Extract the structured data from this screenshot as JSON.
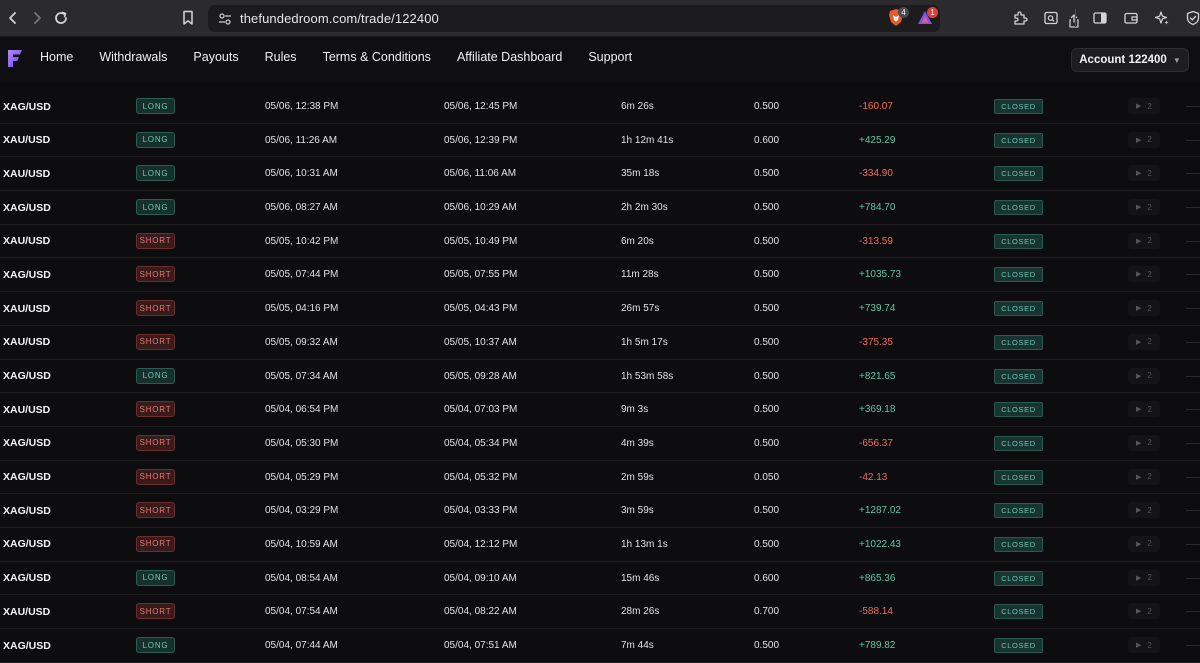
{
  "browser": {
    "url": "thefundedroom.com/trade/122400",
    "brave_badge": "4",
    "rewards_badge": "1"
  },
  "nav": {
    "items": [
      "Home",
      "Withdrawals",
      "Payouts",
      "Rules",
      "Terms & Conditions",
      "Affiliate Dashboard",
      "Support"
    ],
    "account_label": "Account 122400"
  },
  "trades": [
    {
      "symbol": "XAG/USD",
      "direction": "LONG",
      "open": "05/06, 12:38 PM",
      "close": "05/06, 12:45 PM",
      "duration": "6m 26s",
      "size": "0.500",
      "pnl": "-160.07",
      "status": "CLOSED",
      "count": "2"
    },
    {
      "symbol": "XAU/USD",
      "direction": "LONG",
      "open": "05/06, 11:26 AM",
      "close": "05/06, 12:39 PM",
      "duration": "1h 12m 41s",
      "size": "0.600",
      "pnl": "+425.29",
      "status": "CLOSED",
      "count": "2"
    },
    {
      "symbol": "XAU/USD",
      "direction": "LONG",
      "open": "05/06, 10:31 AM",
      "close": "05/06, 11:06 AM",
      "duration": "35m 18s",
      "size": "0.500",
      "pnl": "-334.90",
      "status": "CLOSED",
      "count": "2"
    },
    {
      "symbol": "XAG/USD",
      "direction": "LONG",
      "open": "05/06, 08:27 AM",
      "close": "05/06, 10:29 AM",
      "duration": "2h 2m 30s",
      "size": "0.500",
      "pnl": "+784.70",
      "status": "CLOSED",
      "count": "2"
    },
    {
      "symbol": "XAU/USD",
      "direction": "SHORT",
      "open": "05/05, 10:42 PM",
      "close": "05/05, 10:49 PM",
      "duration": "6m 20s",
      "size": "0.500",
      "pnl": "-313.59",
      "status": "CLOSED",
      "count": "2"
    },
    {
      "symbol": "XAG/USD",
      "direction": "SHORT",
      "open": "05/05, 07:44 PM",
      "close": "05/05, 07:55 PM",
      "duration": "11m 28s",
      "size": "0.500",
      "pnl": "+1035.73",
      "status": "CLOSED",
      "count": "2"
    },
    {
      "symbol": "XAU/USD",
      "direction": "SHORT",
      "open": "05/05, 04:16 PM",
      "close": "05/05, 04:43 PM",
      "duration": "26m 57s",
      "size": "0.500",
      "pnl": "+739.74",
      "status": "CLOSED",
      "count": "2"
    },
    {
      "symbol": "XAU/USD",
      "direction": "SHORT",
      "open": "05/05, 09:32 AM",
      "close": "05/05, 10:37 AM",
      "duration": "1h 5m 17s",
      "size": "0.500",
      "pnl": "-375.35",
      "status": "CLOSED",
      "count": "2"
    },
    {
      "symbol": "XAG/USD",
      "direction": "LONG",
      "open": "05/05, 07:34 AM",
      "close": "05/05, 09:28 AM",
      "duration": "1h 53m 58s",
      "size": "0.500",
      "pnl": "+821.65",
      "status": "CLOSED",
      "count": "2"
    },
    {
      "symbol": "XAU/USD",
      "direction": "SHORT",
      "open": "05/04, 06:54 PM",
      "close": "05/04, 07:03 PM",
      "duration": "9m 3s",
      "size": "0.500",
      "pnl": "+369.18",
      "status": "CLOSED",
      "count": "2"
    },
    {
      "symbol": "XAG/USD",
      "direction": "SHORT",
      "open": "05/04, 05:30 PM",
      "close": "05/04, 05:34 PM",
      "duration": "4m 39s",
      "size": "0.500",
      "pnl": "-656.37",
      "status": "CLOSED",
      "count": "2"
    },
    {
      "symbol": "XAG/USD",
      "direction": "SHORT",
      "open": "05/04, 05:29 PM",
      "close": "05/04, 05:32 PM",
      "duration": "2m 59s",
      "size": "0.050",
      "pnl": "-42.13",
      "status": "CLOSED",
      "count": "2"
    },
    {
      "symbol": "XAG/USD",
      "direction": "SHORT",
      "open": "05/04, 03:29 PM",
      "close": "05/04, 03:33 PM",
      "duration": "3m 59s",
      "size": "0.500",
      "pnl": "+1287.02",
      "status": "CLOSED",
      "count": "2"
    },
    {
      "symbol": "XAG/USD",
      "direction": "SHORT",
      "open": "05/04, 10:59 AM",
      "close": "05/04, 12:12 PM",
      "duration": "1h 13m 1s",
      "size": "0.500",
      "pnl": "+1022.43",
      "status": "CLOSED",
      "count": "2"
    },
    {
      "symbol": "XAG/USD",
      "direction": "LONG",
      "open": "05/04, 08:54 AM",
      "close": "05/04, 09:10 AM",
      "duration": "15m 46s",
      "size": "0.600",
      "pnl": "+865.36",
      "status": "CLOSED",
      "count": "2"
    },
    {
      "symbol": "XAU/USD",
      "direction": "SHORT",
      "open": "05/04, 07:54 AM",
      "close": "05/04, 08:22 AM",
      "duration": "28m 26s",
      "size": "0.700",
      "pnl": "-588.14",
      "status": "CLOSED",
      "count": "2"
    },
    {
      "symbol": "XAG/USD",
      "direction": "LONG",
      "open": "05/04, 07:44 AM",
      "close": "05/04, 07:51 AM",
      "duration": "7m 44s",
      "size": "0.500",
      "pnl": "+789.82",
      "status": "CLOSED",
      "count": "2"
    }
  ],
  "colors": {
    "positive": "#5ec7a6",
    "negative": "#ef6b5e",
    "long": "#69c7b4",
    "short": "#e07a72"
  }
}
